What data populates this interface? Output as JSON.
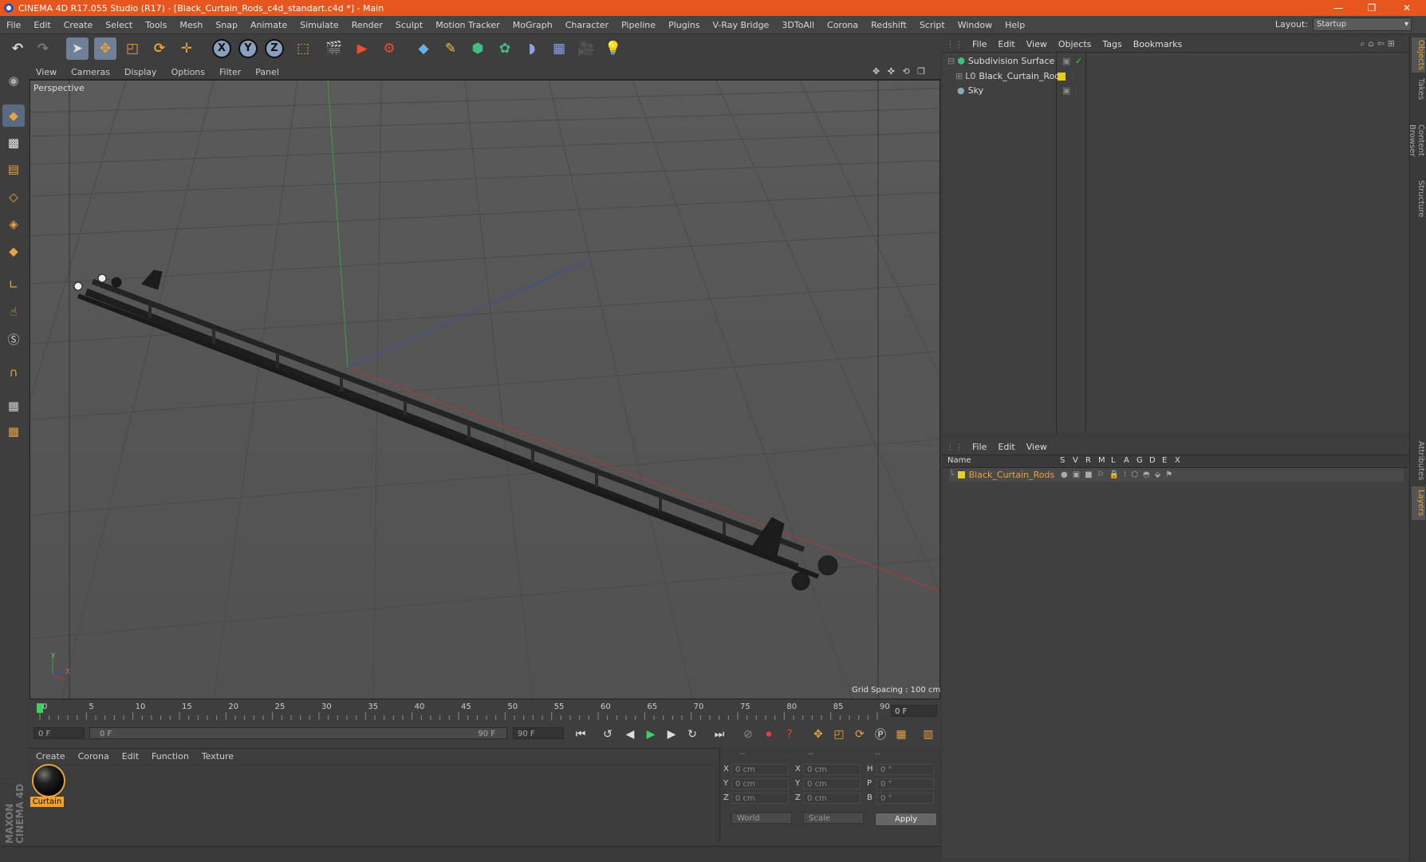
{
  "window": {
    "title": "CINEMA 4D R17.055 Studio (R17) - [Black_Curtain_Rods_c4d_standart.c4d *] - Main",
    "controls": [
      "—",
      "❐",
      "✕"
    ]
  },
  "menubar": {
    "items": [
      "File",
      "Edit",
      "Create",
      "Select",
      "Tools",
      "Mesh",
      "Snap",
      "Animate",
      "Simulate",
      "Render",
      "Sculpt",
      "Motion Tracker",
      "MoGraph",
      "Character",
      "Pipeline",
      "Plugins",
      "V-Ray Bridge",
      "3DToAll",
      "Corona",
      "Redshift",
      "Script",
      "Window",
      "Help"
    ],
    "layout_label": "Layout:",
    "layout_value": "Startup"
  },
  "toolbar": {
    "icons": [
      "undo-icon",
      "redo-icon",
      "select-pointer-icon",
      "move-icon",
      "scale-icon",
      "rotate-icon",
      "transform-icon",
      "axis-x-icon",
      "axis-y-icon",
      "axis-z-icon",
      "coordinate-system-icon",
      "render-view-icon",
      "render-picture-viewer-icon",
      "render-settings-icon",
      "cube-icon",
      "pen-icon",
      "subdivision-icon",
      "array-icon",
      "deformer-icon",
      "floor-icon",
      "camera-icon",
      "light-icon"
    ],
    "axis_labels": [
      "X",
      "Y",
      "Z"
    ]
  },
  "viewport": {
    "menu": [
      "View",
      "Cameras",
      "Display",
      "Options",
      "Filter",
      "Panel"
    ],
    "nav_icons": "✥ ✜ ⟲ ❐",
    "label": "Perspective",
    "grid_spacing": "Grid Spacing : 100 cm",
    "axis_labels": {
      "y": "Y",
      "x": "X"
    }
  },
  "timeline": {
    "ticks": [
      "0",
      "5",
      "10",
      "15",
      "20",
      "25",
      "30",
      "35",
      "40",
      "45",
      "50",
      "55",
      "60",
      "65",
      "70",
      "75",
      "80",
      "85",
      "90"
    ],
    "current_frame": "0 F",
    "start_field": "0 F",
    "range_start": "0 F",
    "range_end": "90 F",
    "end_field": "90 F"
  },
  "material_manager": {
    "menu": [
      "Create",
      "Corona",
      "Edit",
      "Function",
      "Texture"
    ],
    "materials": [
      {
        "name": "Curtain"
      }
    ]
  },
  "coordinates": {
    "header": [
      "--",
      "--",
      "--"
    ],
    "rows": [
      {
        "a": "X",
        "v1": "0 cm",
        "b": "X",
        "v2": "0 cm",
        "c": "H",
        "v3": "0 °"
      },
      {
        "a": "Y",
        "v1": "0 cm",
        "b": "Y",
        "v2": "0 cm",
        "c": "P",
        "v3": "0 °"
      },
      {
        "a": "Z",
        "v1": "0 cm",
        "b": "Z",
        "v2": "0 cm",
        "c": "B",
        "v3": "0 °"
      }
    ],
    "mode1": "World",
    "mode2": "Scale",
    "apply": "Apply"
  },
  "object_manager": {
    "menu": [
      "File",
      "Edit",
      "View",
      "Objects",
      "Tags",
      "Bookmarks"
    ],
    "objects": [
      {
        "name": "Subdivision Surface",
        "indent": 0
      },
      {
        "name": "Black_Curtain_Rods",
        "indent": 1
      },
      {
        "name": "Sky",
        "indent": 0
      }
    ]
  },
  "layer_manager": {
    "menu": [
      "File",
      "Edit",
      "View"
    ],
    "columns": [
      "Name",
      "S",
      "V",
      "R",
      "M",
      "L",
      "A",
      "G",
      "D",
      "E",
      "X"
    ],
    "layers": [
      {
        "name": "Black_Curtain_Rods",
        "color": "#e8d020"
      }
    ]
  },
  "side_tabs": [
    "Objects",
    "Takes",
    "Content Browser",
    "Structure",
    "Attributes",
    "Layers"
  ],
  "brand": "MAXON CINEMA 4D",
  "colors": {
    "titlebar": "#e8561f",
    "accent": "#f0a030",
    "x_axis": "#c04040",
    "y_axis": "#40a040",
    "z_axis": "#4050c0"
  }
}
